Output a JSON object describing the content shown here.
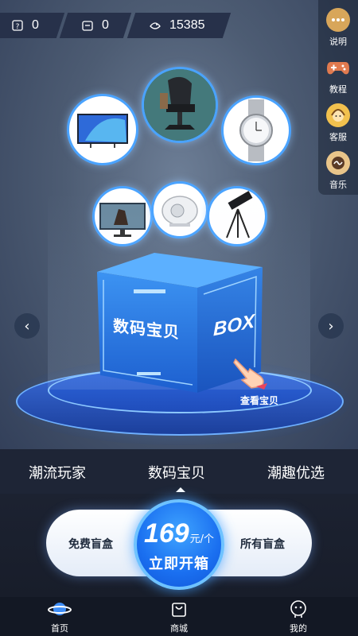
{
  "stats": [
    {
      "icon": "question-box-icon",
      "value": "0"
    },
    {
      "icon": "box-icon",
      "value": "0"
    },
    {
      "icon": "coin-icon",
      "value": "15385"
    }
  ],
  "side_menu": [
    {
      "icon": "more-dots-icon",
      "label": "说明"
    },
    {
      "icon": "gamepad-icon",
      "label": "教程"
    },
    {
      "icon": "customer-service-icon",
      "label": "客服"
    },
    {
      "icon": "music-icon",
      "label": "音乐"
    }
  ],
  "products": [
    {
      "name": "tv",
      "icon": "tv-image"
    },
    {
      "name": "gaming-chair",
      "icon": "gaming-chair-image"
    },
    {
      "name": "watch",
      "icon": "watch-image"
    },
    {
      "name": "monitor",
      "icon": "monitor-image"
    },
    {
      "name": "speaker",
      "icon": "speaker-image"
    },
    {
      "name": "telescope",
      "icon": "telescope-image"
    }
  ],
  "box": {
    "front_text": "数码宝贝",
    "side_text": "BOX",
    "view_label": "查看宝贝"
  },
  "tabs": {
    "items": [
      "潮流玩家",
      "数码宝贝",
      "潮趣优选"
    ],
    "active_index": 1
  },
  "action": {
    "free_label": "免费盲盒",
    "all_label": "所有盲盒",
    "price": "169",
    "price_unit": "元/个",
    "open_label": "立即开箱"
  },
  "colors": {
    "accent": "#1a6ff0",
    "background": "#1c2230"
  },
  "nav": [
    {
      "icon": "planet-icon",
      "label": "首页",
      "active": true
    },
    {
      "icon": "shopping-bag-icon",
      "label": "商城",
      "active": false
    },
    {
      "icon": "profile-icon",
      "label": "我的",
      "active": false
    }
  ]
}
